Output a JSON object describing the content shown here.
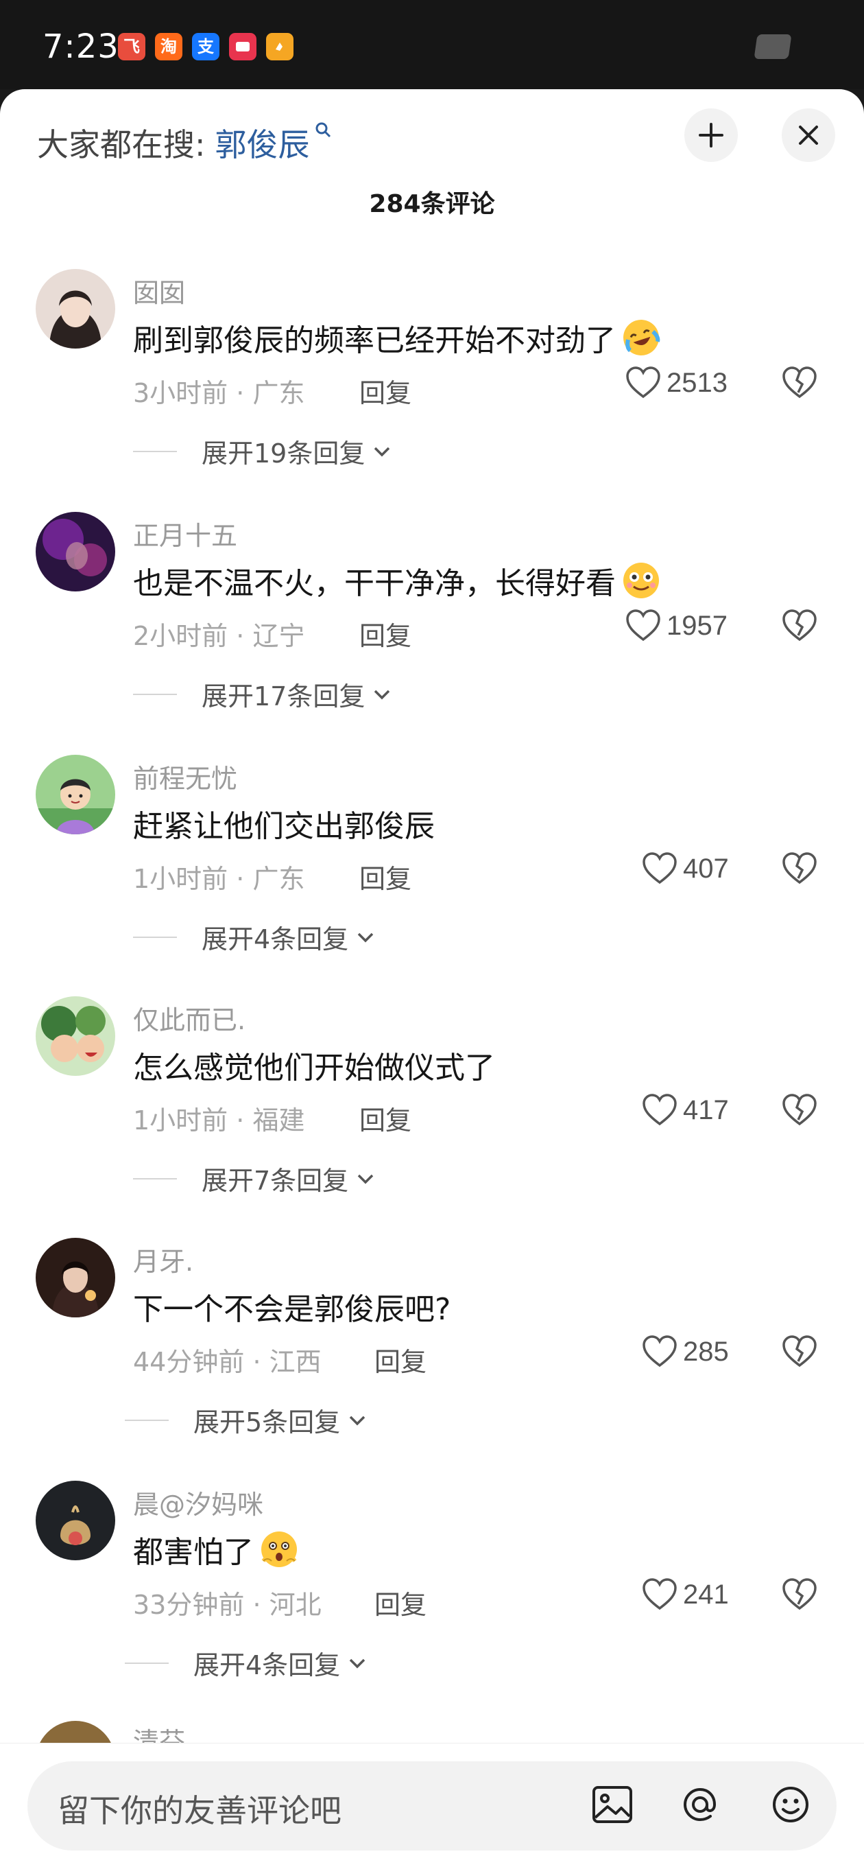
{
  "status_bar": {
    "time": "7:23",
    "app_icons": [
      {
        "name": "app-icon-1",
        "glyph": "飞",
        "color": "#e84d3d"
      },
      {
        "name": "taobao-icon",
        "glyph": "淘",
        "color": "#ff6a1a"
      },
      {
        "name": "alipay-icon",
        "glyph": "支",
        "color": "#1677ff"
      },
      {
        "name": "app-icon-4",
        "glyph": "",
        "color": "#e8344e"
      },
      {
        "name": "app-icon-5",
        "glyph": "",
        "color": "#f5a623"
      }
    ]
  },
  "header": {
    "search_prefix": "大家都在搜:",
    "search_term": "郭俊辰",
    "comment_count": "284条评论"
  },
  "comments": [
    {
      "user": "囡囡",
      "text": "刷到郭俊辰的频率已经开始不对劲了",
      "emoji": "laughing-crying-emoji",
      "time": "3小时前",
      "location": "广东",
      "reply": "回复",
      "likes": "2513",
      "expand": "展开19条回复"
    },
    {
      "user": "正月十五",
      "text": "也是不温不火，干干净净，长得好看",
      "emoji": "smile-emoji",
      "time": "2小时前",
      "location": "辽宁",
      "reply": "回复",
      "likes": "1957",
      "expand": "展开17条回复"
    },
    {
      "user": "前程无忧",
      "text": "赶紧让他们交出郭俊辰",
      "emoji": "",
      "time": "1小时前",
      "location": "广东",
      "reply": "回复",
      "likes": "407",
      "expand": "展开4条回复"
    },
    {
      "user": "仅此而已.",
      "text": "怎么感觉他们开始做仪式了",
      "emoji": "",
      "time": "1小时前",
      "location": "福建",
      "reply": "回复",
      "likes": "417",
      "expand": "展开7条回复"
    },
    {
      "user": "月牙.",
      "text": "下一个不会是郭俊辰吧?",
      "emoji": "",
      "time": "44分钟前",
      "location": "江西",
      "reply": "回复",
      "likes": "285",
      "expand": "展开5条回复"
    },
    {
      "user": "晨@汐妈咪",
      "text": "都害怕了",
      "emoji": "scared-emoji",
      "time": "33分钟前",
      "location": "河北",
      "reply": "回复",
      "likes": "241",
      "expand": "展开4条回复"
    }
  ],
  "partial_comment_user": "清芬",
  "input": {
    "placeholder": "留下你的友善评论吧"
  }
}
